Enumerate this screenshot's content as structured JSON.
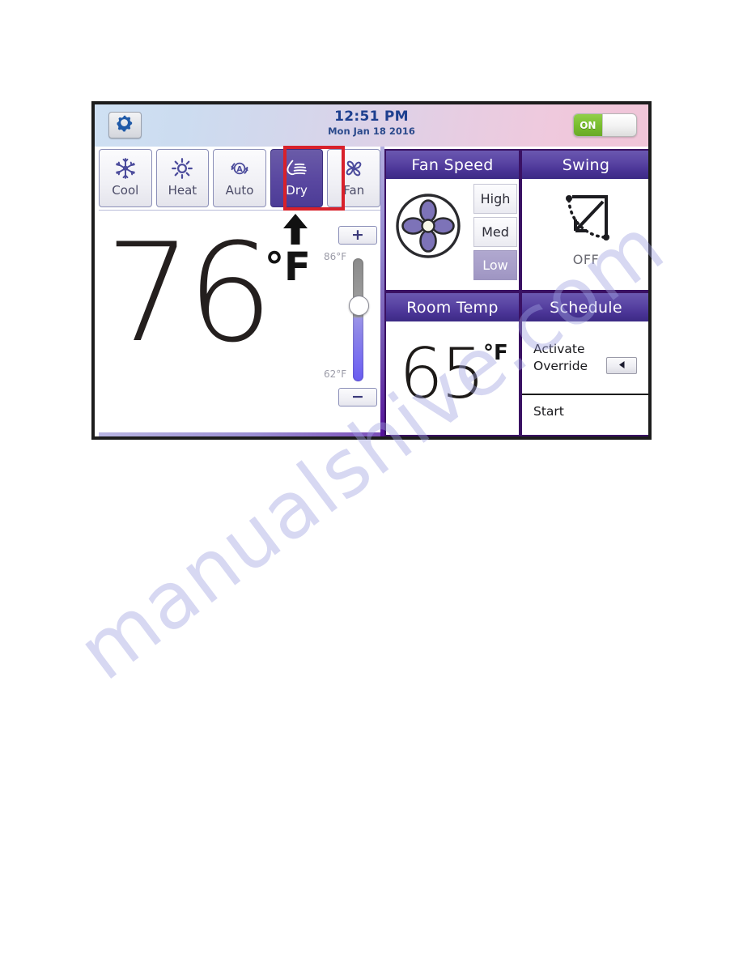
{
  "watermark": {
    "text": "manualshive.com"
  },
  "header": {
    "gear_button": "gear-icon",
    "time": "12:51 PM",
    "date": "Mon Jan 18 2016",
    "power_toggle": {
      "state_label": "ON",
      "is_on": true
    }
  },
  "modes": {
    "items": [
      {
        "label": "Cool",
        "icon": "snowflake-icon",
        "active": false
      },
      {
        "label": "Heat",
        "icon": "sun-icon",
        "active": false
      },
      {
        "label": "Auto",
        "icon": "auto-circle-a-icon",
        "active": false
      },
      {
        "label": "Dry",
        "icon": "water-drop-icon",
        "active": true
      },
      {
        "label": "Fan",
        "icon": "fan-blade-icon",
        "active": false
      }
    ],
    "highlighted": "Dry",
    "highlight_color": "#d8212b"
  },
  "setpoint": {
    "value": "76",
    "unit": "°F",
    "direction_icon": "up-arrow-icon",
    "slider": {
      "max_label": "86°F",
      "min_label": "62°F",
      "plus_label": "+",
      "minus_label": "−"
    }
  },
  "panels": {
    "fan_speed": {
      "title": "Fan Speed",
      "icon": "fan-icon",
      "options": [
        {
          "label": "High",
          "selected": false
        },
        {
          "label": "Med",
          "selected": false
        },
        {
          "label": "Low",
          "selected": true
        }
      ]
    },
    "swing": {
      "title": "Swing",
      "icon": "swing-arc-arrow-icon",
      "status": "OFF"
    },
    "room_temp": {
      "title": "Room Temp",
      "value": "65",
      "unit": "°F"
    },
    "schedule": {
      "title": "Schedule",
      "override_label": "Activate\nOverride",
      "override_line1": "Activate",
      "override_line2": "Override",
      "arrow_button_icon": "triangle-left-icon",
      "start_label": "Start"
    }
  },
  "colors": {
    "accent_purple": "#4a3496",
    "panel_border": "#3a1163",
    "active_mode": "#5947a0",
    "highlight_red": "#d8212b",
    "toggle_green": "#78bd2e",
    "slider_blue": "#7a6ff0"
  }
}
